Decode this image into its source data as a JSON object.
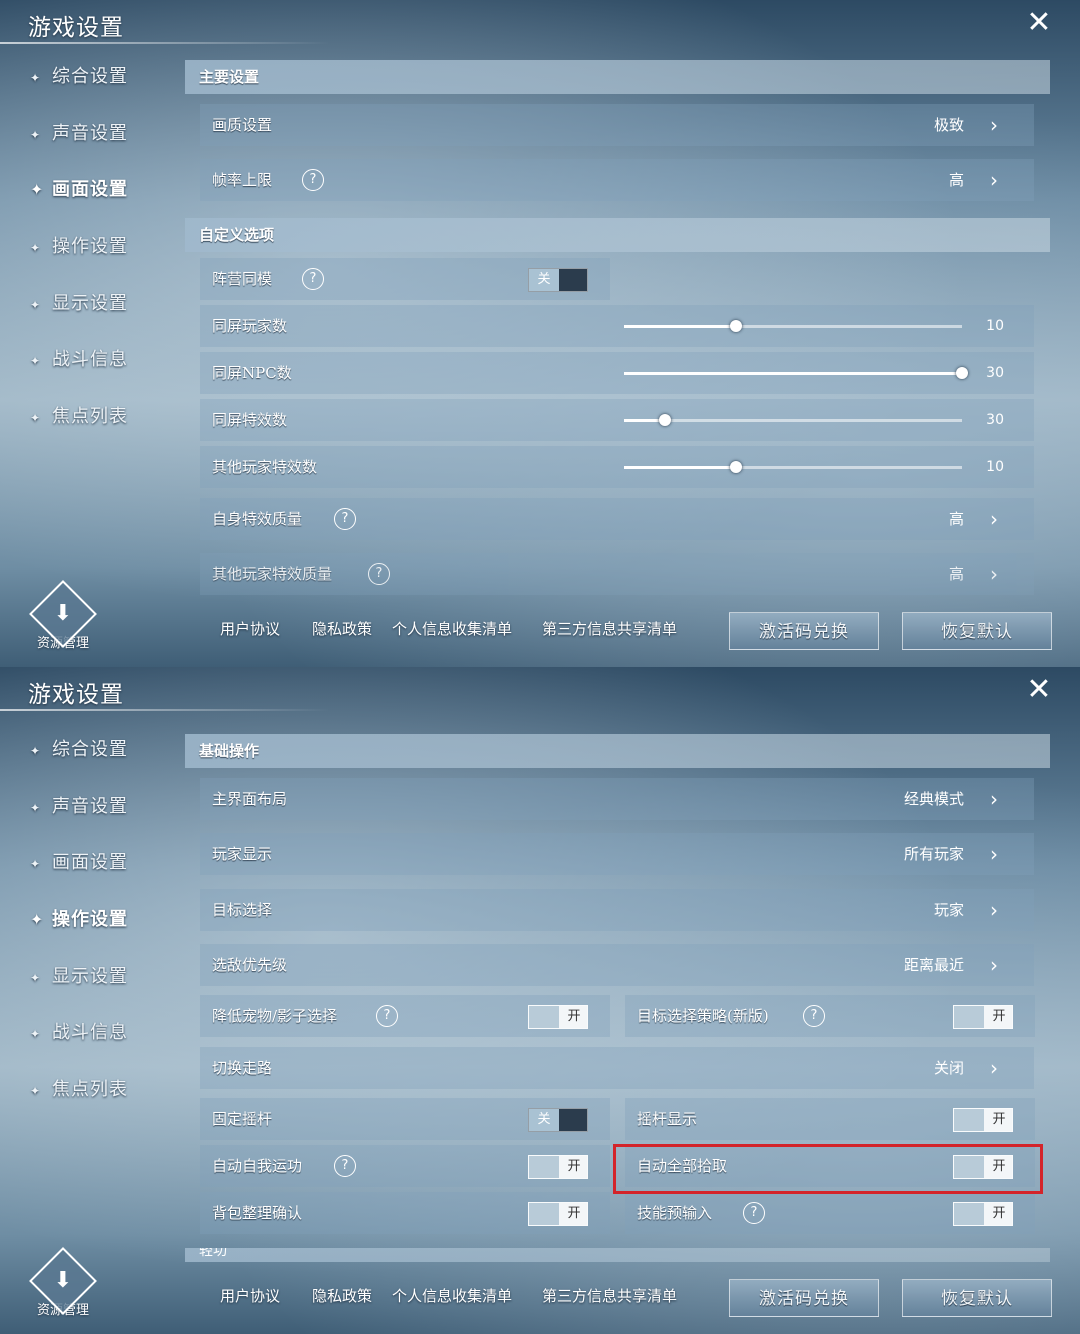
{
  "panels": [
    {
      "title": "游戏设置",
      "close_icon": "✕",
      "sidebar": [
        "综合设置",
        "声音设置",
        "画面设置",
        "操作设置",
        "显示设置",
        "战斗信息",
        "焦点列表"
      ],
      "active_index": 2,
      "sections": [
        {
          "header": "主要设置"
        },
        {
          "header": "自定义选项"
        }
      ],
      "rows": {
        "quality": {
          "label": "画质设置",
          "value": "极致"
        },
        "fps": {
          "label": "帧率上限",
          "value": "高"
        },
        "camp": {
          "label": "阵营同模",
          "toggle": "关"
        },
        "players": {
          "label": "同屏玩家数",
          "value": "10",
          "fraction": 0.33
        },
        "npcs": {
          "label": "同屏NPC数",
          "value": "30",
          "fraction": 1.0
        },
        "effects": {
          "label": "同屏特效数",
          "value": "30",
          "fraction": 0.12
        },
        "other_effects": {
          "label": "其他玩家特效数",
          "value": "10",
          "fraction": 0.33
        },
        "self_quality": {
          "label": "自身特效质量",
          "value": "高"
        },
        "other_quality": {
          "label": "其他玩家特效质量",
          "value": "高"
        }
      },
      "resource": "资源管理",
      "links": [
        "用户协议",
        "隐私政策",
        "个人信息收集清单",
        "第三方信息共享清单"
      ],
      "buttons": [
        "激活码兑换",
        "恢复默认"
      ]
    },
    {
      "title": "游戏设置",
      "close_icon": "✕",
      "sidebar": [
        "综合设置",
        "声音设置",
        "画面设置",
        "操作设置",
        "显示设置",
        "战斗信息",
        "焦点列表"
      ],
      "active_index": 3,
      "sections": [
        {
          "header": "基础操作"
        },
        {
          "header": "轻功"
        }
      ],
      "rows": {
        "layout": {
          "label": "主界面布局",
          "value": "经典模式"
        },
        "player_display": {
          "label": "玩家显示",
          "value": "所有玩家"
        },
        "target": {
          "label": "目标选择",
          "value": "玩家"
        },
        "priority": {
          "label": "选敌优先级",
          "value": "距离最近"
        },
        "lower_pet": {
          "label": "降低宠物/影子选择",
          "toggle": "开"
        },
        "target_strategy": {
          "label": "目标选择策略(新版)",
          "toggle": "开"
        },
        "switch_walk": {
          "label": "切换走路",
          "value": "关闭"
        },
        "fixed_joystick": {
          "label": "固定摇杆",
          "toggle": "关"
        },
        "joystick_display": {
          "label": "摇杆显示",
          "toggle": "开"
        },
        "auto_exercise": {
          "label": "自动自我运功",
          "toggle": "开"
        },
        "auto_pickup": {
          "label": "自动全部拾取",
          "toggle": "开"
        },
        "bag_confirm": {
          "label": "背包整理确认",
          "toggle": "开"
        },
        "skill_preinput": {
          "label": "技能预输入",
          "toggle": "开"
        }
      },
      "resource": "资源管理",
      "links": [
        "用户协议",
        "隐私政策",
        "个人信息收集清单",
        "第三方信息共享清单"
      ],
      "buttons": [
        "激活码兑换",
        "恢复默认"
      ]
    }
  ],
  "chevron": "›",
  "help": "?",
  "highlight_color": "#d4242a"
}
